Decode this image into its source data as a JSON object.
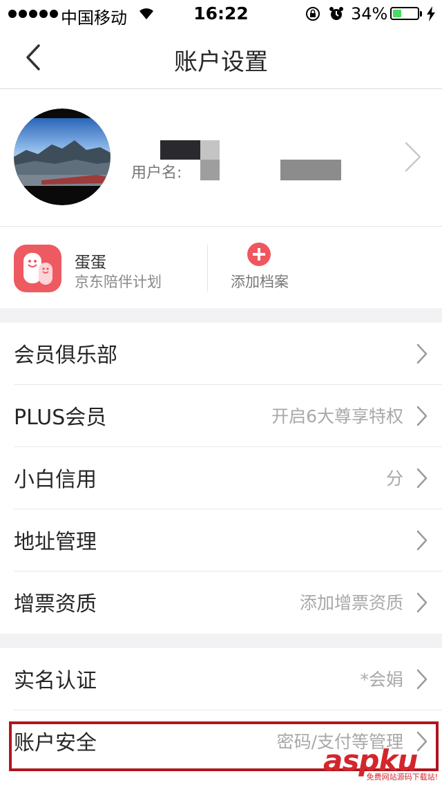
{
  "status_bar": {
    "carrier": "中国移动",
    "time": "16:22",
    "battery": "34%",
    "battery_level": 0.34,
    "icons": [
      "signal-dots-icon",
      "wifi-icon",
      "rotation-lock-icon",
      "alarm-icon",
      "battery-icon",
      "charging-bolt-icon"
    ]
  },
  "nav": {
    "title": "账户设置",
    "back_icon": "back-chevron-icon"
  },
  "profile": {
    "username_label": "用户名:",
    "chevron_icon": "chevron-right-icon"
  },
  "kid_plan": {
    "name": "蛋蛋",
    "subtitle": "京东陪伴计划",
    "add_label": "添加档案",
    "accent": "#ee5a61"
  },
  "menu": [
    {
      "label": "会员俱乐部",
      "value": ""
    },
    {
      "label": "PLUS会员",
      "value": "开启6大尊享特权"
    },
    {
      "label": "小白信用",
      "value": "分"
    },
    {
      "label": "地址管理",
      "value": ""
    },
    {
      "label": "增票资质",
      "value": "添加增票资质"
    },
    {
      "label": "实名认证",
      "value": "*会娟"
    },
    {
      "label": "账户安全",
      "value": "密码/支付等管理"
    }
  ],
  "watermark": {
    "text": "aspku",
    "sub": "免费网站源码下载站!",
    "color": "#d3262c"
  },
  "colors": {
    "highlight_border": "#b0161d",
    "battery_fill": "#4cd964",
    "background": "#f2f2f4"
  }
}
